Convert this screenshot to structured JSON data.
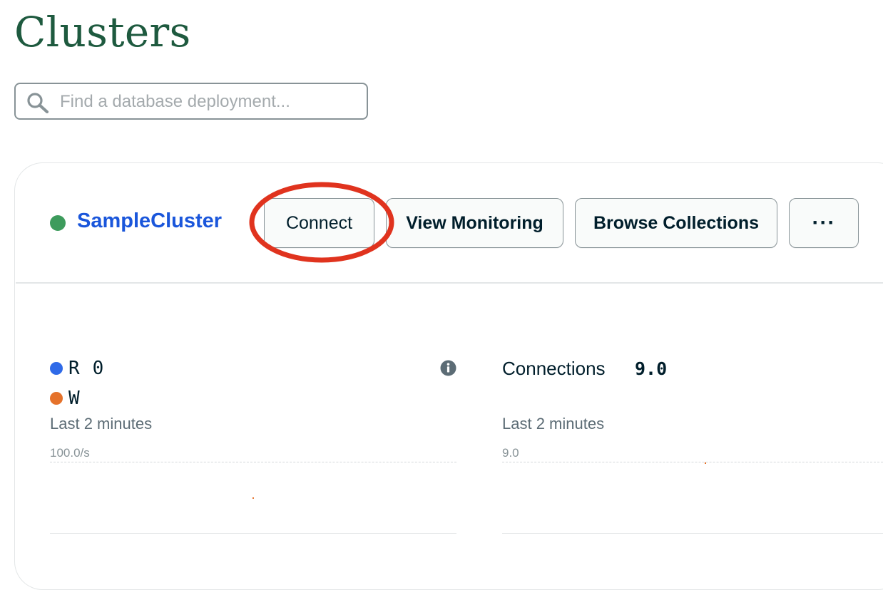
{
  "page": {
    "title": "Clusters"
  },
  "search": {
    "placeholder": "Find a database deployment..."
  },
  "cluster": {
    "name": "SampleCluster",
    "status_color": "#3d9b5c",
    "actions": {
      "connect": "Connect",
      "view_monitoring": "View Monitoring",
      "browse_collections": "Browse Collections",
      "more": "···"
    },
    "annotation": {
      "shape": "ellipse",
      "color": "#e0331e",
      "target": "connect"
    }
  },
  "metrics": {
    "ops": {
      "read_label": "R",
      "read_value": "0",
      "read_color": "#2f6ae8",
      "write_label": "W",
      "write_color": "#e5722b",
      "timespan": "Last 2 minutes",
      "axis_max": "100.0/s",
      "info_icon": "info-icon"
    },
    "connections": {
      "label": "Connections",
      "value": "9.0",
      "timespan": "Last 2 minutes",
      "axis_max": "9.0"
    }
  },
  "colors": {
    "title": "#1e5a3f",
    "link": "#1a56db",
    "border": "#889397"
  }
}
